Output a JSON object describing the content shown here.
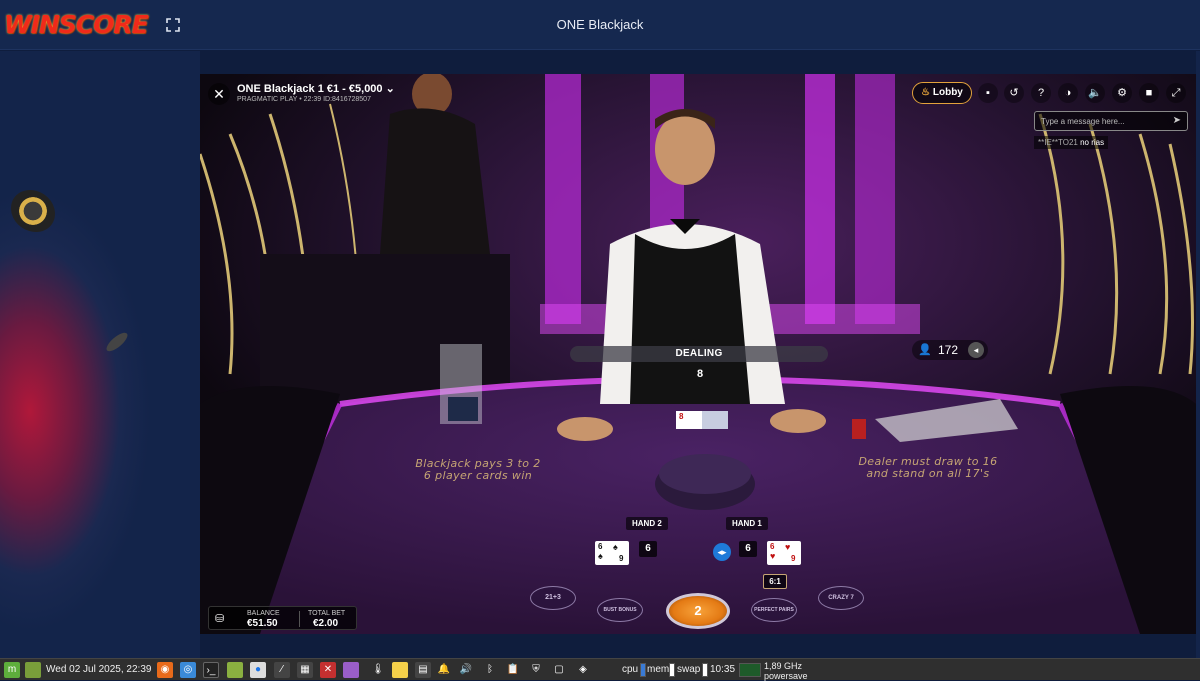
{
  "header": {
    "logo_text": "WINSCORE",
    "page_title": "ONE Blackjack"
  },
  "game": {
    "table_name": "ONE Blackjack 1 €1 - €5,000",
    "table_meta": "PRAGMATIC PLAY • 22:39 ID:8416728507",
    "lobby_label": "Lobby",
    "chat_placeholder": "Type a message here...",
    "chat_message": {
      "user": "**IE**TO21",
      "text": "no rias"
    },
    "status": "DEALING",
    "status_count": "8",
    "players_count": "172",
    "table_text_left": [
      "Blackjack pays 3 to 2",
      "6 player cards win"
    ],
    "table_text_right": [
      "Dealer must draw to 16",
      "and stand on all 17's"
    ],
    "hand2": {
      "label": "HAND 2",
      "score": "6",
      "cards": [
        "6",
        "9"
      ]
    },
    "hand1": {
      "label": "HAND 1",
      "score": "6",
      "cards": [
        "6",
        "9"
      ]
    },
    "dealer_card": "8",
    "side_bets": [
      "21+3",
      "BUST BONUS",
      "PERFECT PAIRS",
      "CRAZY 7"
    ],
    "chip_value": "2",
    "payout": "6:1",
    "balance_label": "BALANCE",
    "balance_value": "€51.50",
    "total_bet_label": "TOTAL BET",
    "total_bet_value": "€2.00"
  },
  "taskbar": {
    "clock": "Wed 02 Jul 2025, 22:39",
    "cpu": "cpu",
    "mem": "mem",
    "swap": "swap",
    "time": "10:35",
    "freq": "1,89 GHz",
    "power": "powersave"
  },
  "colors": {
    "header_bg": "#15284f",
    "page_bg": "#0f1d3d",
    "table_felt": "#3b1a4f",
    "accent_gold": "#c6a574",
    "neon": "#d53cf0"
  }
}
